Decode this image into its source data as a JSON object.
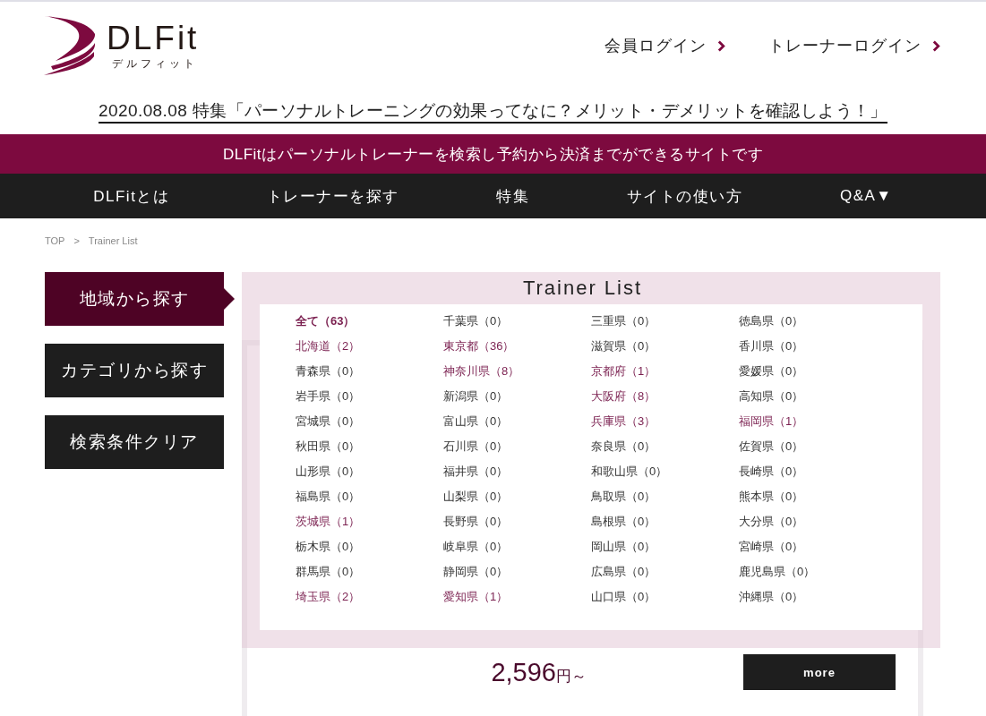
{
  "header": {
    "logo": {
      "name": "DLFit",
      "reading": "デルフィット"
    },
    "links": [
      "会員ログイン",
      "トレーナーログイン"
    ]
  },
  "news": {
    "text": "2020.08.08 特集「パーソナルトレーニングの効果ってなに？メリット・デメリットを確認しよう！」"
  },
  "tagline": "DLFitはパーソナルトレーナーを検索し予約から決済までができるサイトです",
  "nav": [
    "DLFitとは",
    "トレーナーを探す",
    "特集",
    "サイトの使い方",
    "Q&A▼"
  ],
  "breadcrumb": {
    "items": [
      "TOP",
      "Trainer List"
    ],
    "separator": ">"
  },
  "sidebar": [
    {
      "label": "地域から探す",
      "selected": true
    },
    {
      "label": "カテゴリから探す",
      "selected": false
    },
    {
      "label": "検索条件クリア",
      "selected": false
    }
  ],
  "trainer_list": {
    "title": "Trainer List",
    "card": {
      "price": "2,596",
      "price_unit": "円～",
      "button": "more"
    }
  },
  "region_panel": {
    "prefectures": [
      {
        "label": "全て（63）",
        "selected": true,
        "available": true
      },
      {
        "label": "北海道（2）",
        "selected": false,
        "available": true
      },
      {
        "label": "青森県（0）",
        "selected": false,
        "available": false
      },
      {
        "label": "岩手県（0）",
        "selected": false,
        "available": false
      },
      {
        "label": "宮城県（0）",
        "selected": false,
        "available": false
      },
      {
        "label": "秋田県（0）",
        "selected": false,
        "available": false
      },
      {
        "label": "山形県（0）",
        "selected": false,
        "available": false
      },
      {
        "label": "福島県（0）",
        "selected": false,
        "available": false
      },
      {
        "label": "茨城県（1）",
        "selected": false,
        "available": true
      },
      {
        "label": "栃木県（0）",
        "selected": false,
        "available": false
      },
      {
        "label": "群馬県（0）",
        "selected": false,
        "available": false
      },
      {
        "label": "埼玉県（2）",
        "selected": false,
        "available": true
      },
      {
        "label": "千葉県（0）",
        "selected": false,
        "available": false
      },
      {
        "label": "東京都（36）",
        "selected": false,
        "available": true
      },
      {
        "label": "神奈川県（8）",
        "selected": false,
        "available": true
      },
      {
        "label": "新潟県（0）",
        "selected": false,
        "available": false
      },
      {
        "label": "富山県（0）",
        "selected": false,
        "available": false
      },
      {
        "label": "石川県（0）",
        "selected": false,
        "available": false
      },
      {
        "label": "福井県（0）",
        "selected": false,
        "available": false
      },
      {
        "label": "山梨県（0）",
        "selected": false,
        "available": false
      },
      {
        "label": "長野県（0）",
        "selected": false,
        "available": false
      },
      {
        "label": "岐阜県（0）",
        "selected": false,
        "available": false
      },
      {
        "label": "静岡県（0）",
        "selected": false,
        "available": false
      },
      {
        "label": "愛知県（1）",
        "selected": false,
        "available": true
      },
      {
        "label": "三重県（0）",
        "selected": false,
        "available": false
      },
      {
        "label": "滋賀県（0）",
        "selected": false,
        "available": false
      },
      {
        "label": "京都府（1）",
        "selected": false,
        "available": true
      },
      {
        "label": "大阪府（8）",
        "selected": false,
        "available": true
      },
      {
        "label": "兵庫県（3）",
        "selected": false,
        "available": true
      },
      {
        "label": "奈良県（0）",
        "selected": false,
        "available": false
      },
      {
        "label": "和歌山県（0）",
        "selected": false,
        "available": false
      },
      {
        "label": "鳥取県（0）",
        "selected": false,
        "available": false
      },
      {
        "label": "島根県（0）",
        "selected": false,
        "available": false
      },
      {
        "label": "岡山県（0）",
        "selected": false,
        "available": false
      },
      {
        "label": "広島県（0）",
        "selected": false,
        "available": false
      },
      {
        "label": "山口県（0）",
        "selected": false,
        "available": false
      },
      {
        "label": "徳島県（0）",
        "selected": false,
        "available": false
      },
      {
        "label": "香川県（0）",
        "selected": false,
        "available": false
      },
      {
        "label": "愛媛県（0）",
        "selected": false,
        "available": false
      },
      {
        "label": "高知県（0）",
        "selected": false,
        "available": false
      },
      {
        "label": "福岡県（1）",
        "selected": false,
        "available": true
      },
      {
        "label": "佐賀県（0）",
        "selected": false,
        "available": false
      },
      {
        "label": "長崎県（0）",
        "selected": false,
        "available": false
      },
      {
        "label": "熊本県（0）",
        "selected": false,
        "available": false
      },
      {
        "label": "大分県（0）",
        "selected": false,
        "available": false
      },
      {
        "label": "宮崎県（0）",
        "selected": false,
        "available": false
      },
      {
        "label": "鹿児島県（0）",
        "selected": false,
        "available": false
      },
      {
        "label": "沖縄県（0）",
        "selected": false,
        "available": false
      }
    ]
  }
}
